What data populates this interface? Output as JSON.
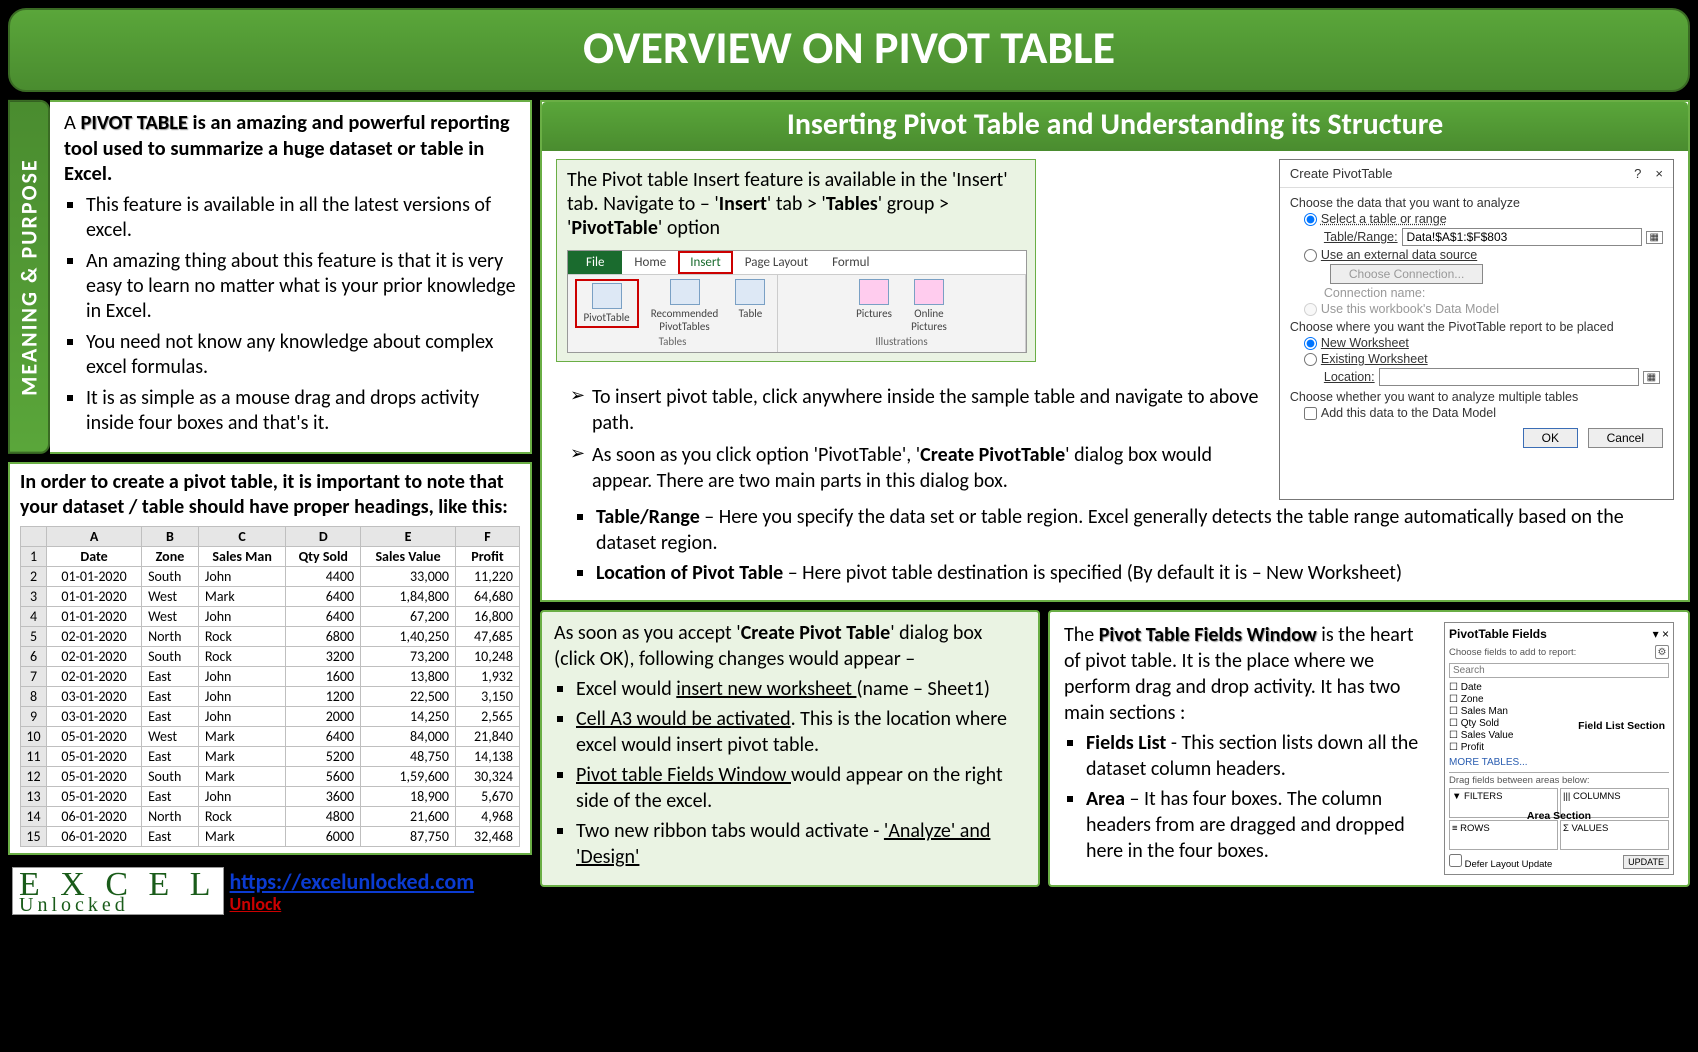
{
  "title": "OVERVIEW ON PIVOT TABLE",
  "meaning": {
    "side_label": "MEANING  &  PURPOSE",
    "intro_a": "A ",
    "intro_b": "PIVOT TABLE",
    "intro_c": " is an amazing and powerful reporting tool used to summarize a huge dataset or table in Excel.",
    "bullets": [
      "This feature is available in all the latest versions of excel.",
      "An amazing thing about this feature is that it is very easy to learn no matter what is your prior knowledge in Excel.",
      "You need not know any knowledge about complex excel formulas.",
      "It is as simple as a mouse drag and drops activity inside four boxes and that's it."
    ]
  },
  "dataset": {
    "note": "In order to create a pivot table, it is important to note that your dataset / table should have proper headings, like this:",
    "cols": [
      "A",
      "B",
      "C",
      "D",
      "E",
      "F"
    ],
    "headers": [
      "Date",
      "Zone",
      "Sales Man",
      "Qty Sold",
      "Sales Value",
      "Profit"
    ],
    "rows": [
      [
        "01-01-2020",
        "South",
        "John",
        "4400",
        "33,000",
        "11,220"
      ],
      [
        "01-01-2020",
        "West",
        "Mark",
        "6400",
        "1,84,800",
        "64,680"
      ],
      [
        "01-01-2020",
        "West",
        "John",
        "6400",
        "67,200",
        "16,800"
      ],
      [
        "02-01-2020",
        "North",
        "Rock",
        "6800",
        "1,40,250",
        "47,685"
      ],
      [
        "02-01-2020",
        "South",
        "Rock",
        "3200",
        "73,200",
        "10,248"
      ],
      [
        "02-01-2020",
        "East",
        "John",
        "1600",
        "13,800",
        "1,932"
      ],
      [
        "03-01-2020",
        "East",
        "John",
        "1200",
        "22,500",
        "3,150"
      ],
      [
        "03-01-2020",
        "East",
        "John",
        "2000",
        "14,250",
        "2,565"
      ],
      [
        "05-01-2020",
        "West",
        "Mark",
        "6400",
        "84,000",
        "21,840"
      ],
      [
        "05-01-2020",
        "East",
        "Mark",
        "5200",
        "48,750",
        "14,138"
      ],
      [
        "05-01-2020",
        "South",
        "Mark",
        "5600",
        "1,59,600",
        "30,324"
      ],
      [
        "05-01-2020",
        "East",
        "John",
        "3600",
        "18,900",
        "5,670"
      ],
      [
        "06-01-2020",
        "North",
        "Rock",
        "4800",
        "21,600",
        "4,968"
      ],
      [
        "06-01-2020",
        "East",
        "Mark",
        "6000",
        "87,750",
        "32,468"
      ]
    ]
  },
  "logo": {
    "top": "E X C E L",
    "bottom": "Unlocked",
    "link": "https://excelunlocked.com",
    "unlock": "Unlock"
  },
  "right": {
    "subtitle": "Inserting Pivot Table and Understanding its Structure",
    "nav_p1a": "The Pivot table Insert feature is available in the 'Insert' tab. Navigate to – '",
    "nav_p1b": "Insert",
    "nav_p1c": "' tab > '",
    "nav_p1d": "Tables",
    "nav_p1e": "' group > '",
    "nav_p1f": "PivotTable",
    "nav_p1g": "' option",
    "ribbon": {
      "file": "File",
      "home": "Home",
      "insert": "Insert",
      "layout": "Page Layout",
      "formul": "Formul",
      "btn_pt": "PivotTable",
      "btn_rec": "Recommended PivotTables",
      "btn_table": "Table",
      "btn_pic": "Pictures",
      "btn_online": "Online Pictures",
      "grp_tables": "Tables",
      "grp_ill": "Illustrations"
    },
    "dialog": {
      "title": "Create PivotTable",
      "q": "?",
      "x": "×",
      "lbl1": "Choose the data that you want to analyze",
      "opt1": "Select a table or range",
      "tr_lbl": "Table/Range:",
      "tr_val": "Data!$A$1:$F$803",
      "opt2": "Use an external data source",
      "btn_conn": "Choose Connection...",
      "conn_lbl": "Connection name:",
      "opt3": "Use this workbook's Data Model",
      "lbl2": "Choose where you want the PivotTable report to be placed",
      "opt_new": "New Worksheet",
      "opt_ex": "Existing Worksheet",
      "loc_lbl": "Location:",
      "lbl3": "Choose whether you want to analyze multiple tables",
      "chk": "Add this data to the Data Model",
      "ok": "OK",
      "cancel": "Cancel"
    },
    "chev": [
      "To insert pivot table, click anywhere inside the sample table and navigate to above path.",
      "As soon as you click option 'PivotTable', 'Create PivotTable' dialog box would appear. There are two main parts in this dialog box."
    ],
    "chev2_b1": "Create PivotTable",
    "sq": [
      {
        "b": "Table/Range",
        "t": " – Here you specify the data set or table region. Excel generally detects the table range automatically based on the dataset region."
      },
      {
        "b": "Location of Pivot Table",
        "t": " – Here pivot table destination is specified (By default it is – New Worksheet)"
      }
    ]
  },
  "accept": {
    "p1a": "As soon as you accept '",
    "p1b": "Create Pivot Table",
    "p1c": "' dialog box (click OK), following changes would appear –",
    "items": [
      {
        "pre": "Excel would ",
        "u": "insert new worksheet ",
        "post": "(name – Sheet1)"
      },
      {
        "pre": "",
        "u": "Cell A3 would be activated",
        "post": ". This is the location where excel would insert pivot table."
      },
      {
        "pre": "",
        "u": "Pivot table Fields Window ",
        "post": "would appear on the right side of the excel."
      },
      {
        "pre": "Two new ribbon tabs would activate - ",
        "u": "'Analyze' and 'Design'",
        "post": ""
      }
    ]
  },
  "fields": {
    "p1a": "The ",
    "p1b": "Pivot Table Fields Window",
    "p1c": " is the heart of pivot table. It is the place where we perform drag and drop activity. It has two main sections :",
    "b1": "Fields List",
    "b1t": " - This section lists down all the dataset column headers.",
    "b2": "Area",
    "b2t": " – It has four boxes. The column headers from are dragged and dropped here in the four boxes.",
    "pane": {
      "title": "PivotTable Fields",
      "sub": "Choose fields to add to report:",
      "search": "Search",
      "list": [
        "Date",
        "Zone",
        "Sales Man",
        "Qty Sold",
        "Sales Value",
        "Profit"
      ],
      "more": "MORE TABLES...",
      "drag": "Drag fields between areas below:",
      "filters": "▼ FILTERS",
      "cols": "|||  COLUMNS",
      "rows": "≡  ROWS",
      "vals": "Σ  VALUES",
      "defer": "Defer Layout Update",
      "update": "UPDATE",
      "sec1": "Field List Section",
      "sec2": "Area Section"
    }
  }
}
